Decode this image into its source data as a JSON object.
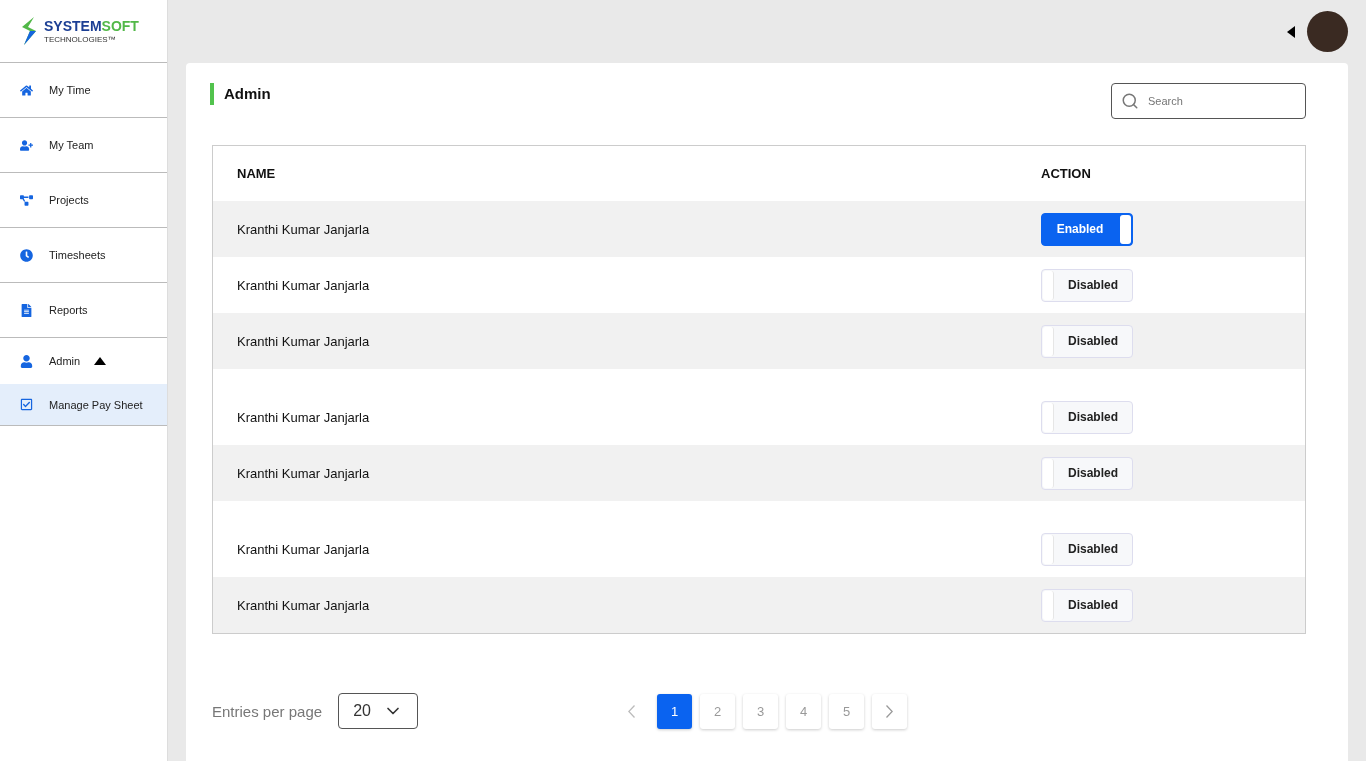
{
  "logo": {
    "name": "SYSTEM",
    "name_accent": "SOFT",
    "tagline": "TECHNOLOGIES™"
  },
  "sidebar": {
    "items": [
      {
        "kind": "home",
        "label": "My Time",
        "selected": false
      },
      {
        "kind": "team",
        "label": "My Team",
        "selected": false
      },
      {
        "kind": "projects",
        "label": "Projects",
        "selected": false
      },
      {
        "kind": "clock",
        "label": "Timesheets",
        "selected": false
      },
      {
        "kind": "file",
        "label": "Reports",
        "selected": false
      },
      {
        "kind": "user",
        "label": "Admin",
        "selected": false,
        "expanded": true,
        "children": [
          {
            "kind": "check",
            "label": "Manage Pay Sheet",
            "selected": true
          }
        ]
      }
    ]
  },
  "page": {
    "title": "Admin",
    "search": {
      "placeholder": "Search"
    }
  },
  "table": {
    "columns": [
      "NAME",
      "ACTION"
    ],
    "rows": [
      {
        "name": "Kranthi Kumar Janjarla",
        "enabled": true,
        "label": "Enabled",
        "spaced": false
      },
      {
        "name": "Kranthi Kumar Janjarla",
        "enabled": false,
        "label": "Disabled",
        "spaced": false
      },
      {
        "name": "Kranthi Kumar Janjarla",
        "enabled": false,
        "label": "Disabled",
        "spaced": false
      },
      {
        "name": "Kranthi Kumar Janjarla",
        "enabled": false,
        "label": "Disabled",
        "spaced": true
      },
      {
        "name": "Kranthi Kumar Janjarla",
        "enabled": false,
        "label": "Disabled",
        "spaced": false
      },
      {
        "name": "Kranthi Kumar Janjarla",
        "enabled": false,
        "label": "Disabled",
        "spaced": true
      },
      {
        "name": "Kranthi Kumar Janjarla",
        "enabled": false,
        "label": "Disabled",
        "spaced": false
      }
    ]
  },
  "pagination": {
    "entries_label": "Entries per page",
    "entries_value": "20",
    "pages": [
      {
        "label": "1",
        "selected": true
      },
      {
        "label": "2",
        "selected": false
      },
      {
        "label": "3",
        "selected": false
      },
      {
        "label": "4",
        "selected": false
      },
      {
        "label": "5",
        "selected": false
      }
    ]
  }
}
